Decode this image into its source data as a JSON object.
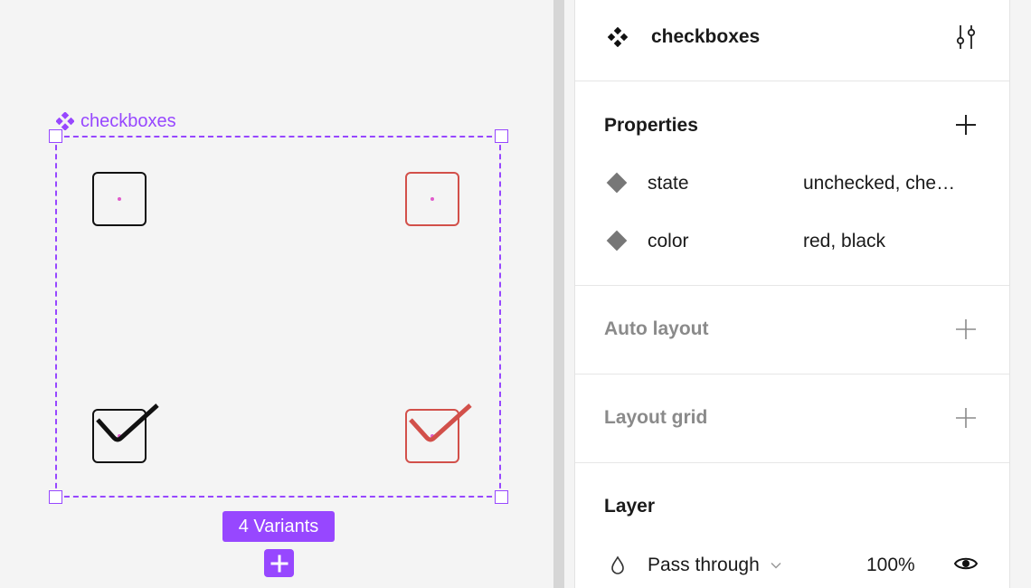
{
  "canvas": {
    "frame_label": "checkboxes",
    "variants_badge": "4 Variants",
    "accent_color": "#9747ff",
    "checkbox_colors": {
      "black": "#111111",
      "red": "#d2504a"
    }
  },
  "panel": {
    "component_name": "checkboxes",
    "properties": {
      "title": "Properties",
      "items": [
        {
          "name": "state",
          "value": "unchecked, che…"
        },
        {
          "name": "color",
          "value": "red, black"
        }
      ]
    },
    "auto_layout": {
      "title": "Auto layout"
    },
    "layout_grid": {
      "title": "Layout grid"
    },
    "layer": {
      "title": "Layer",
      "blend_mode": "Pass through",
      "opacity": "100%"
    }
  },
  "icons": {
    "component": "component-icon",
    "tune": "tune-icon",
    "add": "plus-icon",
    "variant_property": "diamond-icon",
    "blend": "droplet-icon",
    "chevron": "chevron-down-icon",
    "visibility": "eye-icon"
  }
}
